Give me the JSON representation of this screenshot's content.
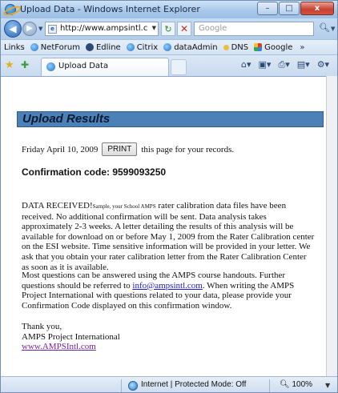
{
  "window": {
    "title": "Upload Data - Windows Internet Explorer",
    "minimize": "–",
    "maximize": "□",
    "close": "x"
  },
  "address_bar": {
    "url": "http://www.ampsintl.c",
    "search_placeholder": "Google"
  },
  "links_bar": {
    "items": [
      {
        "label": "Links",
        "icon": "none"
      },
      {
        "label": "NetForum",
        "icon": "ie-icon"
      },
      {
        "label": "Edline",
        "icon": "edline-icon"
      },
      {
        "label": "Citrix",
        "icon": "ie-icon"
      },
      {
        "label": "dataAdmin",
        "icon": "ie-icon"
      },
      {
        "label": "DNS",
        "icon": "dns-icon"
      },
      {
        "label": "Google",
        "icon": "google-icon"
      }
    ],
    "overflow": "»"
  },
  "tabs": {
    "active_label": "Upload Data"
  },
  "page": {
    "heading": "Upload Results",
    "date_text": "Friday April 10, 2009",
    "print_label": "PRINT",
    "date_suffix": "this page for your records.",
    "confirmation": "Confirmation code: 9599093250",
    "p1_lead": "DATA RECEIVED!",
    "p1_sample": "Sample, your School AMPS",
    "p1_body": " rater calibration data files have been received. No additional confirmation will be sent. Data analysis takes approximately 2-3 weeks. A letter detailing the results of this analysis will be available for download on or before May 1, 2009 from the Rater Calibration center on the ESI website. Time sensitive information will be provided in your letter. We ask that you obtain your rater calibration letter from the Rater Calibration Center as soon as it is available.",
    "p2_before": "Most questions can be answered using the AMPS course handouts. Further questions should be referred to ",
    "p2_email": "info@ampsintl.com",
    "p2_after": ". When writing the AMPS Project International with questions related to your data, please provide your Confirmation Code displayed on this confirmation window.",
    "sig_thanks": "Thank you,",
    "sig_org": "AMPS Project International",
    "sig_web": "www.AMPSIntl.com"
  },
  "status_bar": {
    "zone": "Internet | Protected Mode: Off",
    "zoom": "100%"
  }
}
